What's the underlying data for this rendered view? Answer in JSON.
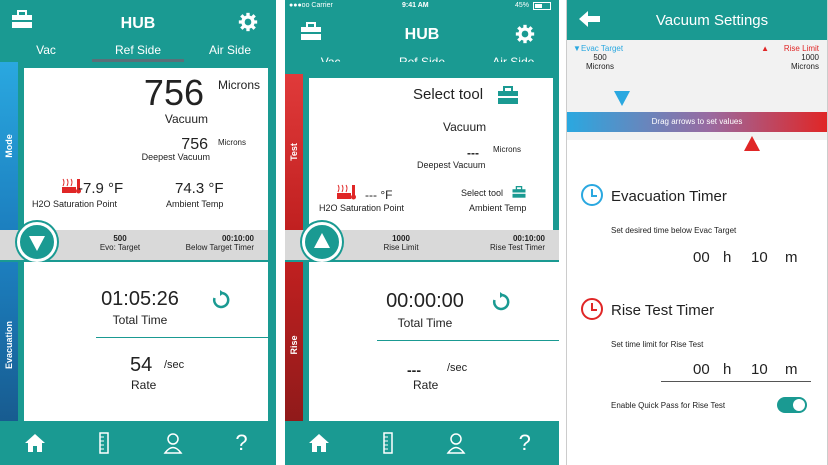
{
  "colors": {
    "teal": "#1a9a92",
    "red_accent": "#e02626",
    "blue_accent": "#2aa8e0"
  },
  "screen1": {
    "title": "HUB",
    "tabs": [
      "Vac",
      "Ref Side",
      "Air Side"
    ],
    "side_labels": {
      "top": "Mode",
      "bottom": "Evacuation"
    },
    "vacuum": {
      "value": "756",
      "unit": "Microns",
      "label": "Vacuum"
    },
    "deepest": {
      "value": "756",
      "unit": "Microns",
      "label": "Deepest Vacuum"
    },
    "h2o": {
      "value": "-7.9 °F",
      "label": "H2O Saturation Point"
    },
    "ambient": {
      "value": "74.3 °F",
      "label": "Ambient Temp"
    },
    "band": {
      "left_value": "500",
      "left_label": "Evo: Target",
      "right_value": "00:10:00",
      "right_label": "Below Target Timer"
    },
    "total_time": {
      "value": "01:05:26",
      "label": "Total Time"
    },
    "rate": {
      "value": "54",
      "unit": "/sec",
      "label": "Rate"
    }
  },
  "screen2": {
    "status": {
      "carrier": "●●●oo Carrier",
      "time": "9:41 AM",
      "battery": "45%"
    },
    "title": "HUB",
    "tabs": [
      "Vac",
      "Ref Side",
      "Air Side"
    ],
    "side_labels": {
      "top": "Test",
      "bottom": "Rise"
    },
    "select_tool": "Select tool",
    "vacuum": {
      "value": "---",
      "unit": "Microns",
      "label": "Vacuum"
    },
    "deepest": {
      "label": "Deepest Vacuum"
    },
    "h2o": {
      "value": "--- °F",
      "label": "H2O Saturation Point"
    },
    "ambient": {
      "value": "Select tool",
      "label": "Ambient Temp"
    },
    "band": {
      "left_value": "1000",
      "left_label": "Rise Limit",
      "right_value": "00:10:00",
      "right_label": "Rise Test Timer"
    },
    "total_time": {
      "value": "00:00:00",
      "label": "Total Time"
    },
    "rate": {
      "value": "---",
      "unit": "/sec",
      "label": "Rate"
    }
  },
  "screen3": {
    "title": "Vacuum Settings",
    "evac_target": {
      "label": "Evac Target",
      "value": "500",
      "unit": "Microns"
    },
    "rise_limit": {
      "label": "Rise Limit",
      "value": "1000",
      "unit": "Microns"
    },
    "slider_label": "Drag arrows to set values",
    "evac_timer": {
      "title": "Evacuation Timer",
      "desc": "Set desired time below Evac Target",
      "h": "00",
      "h_unit": "h",
      "m": "10",
      "m_unit": "m"
    },
    "rise_timer": {
      "title": "Rise Test Timer",
      "desc": "Set time limit for Rise Test",
      "h": "00",
      "h_unit": "h",
      "m": "10",
      "m_unit": "m"
    },
    "quick_pass": {
      "label": "Enable Quick Pass for Rise Test",
      "enabled": true
    }
  }
}
